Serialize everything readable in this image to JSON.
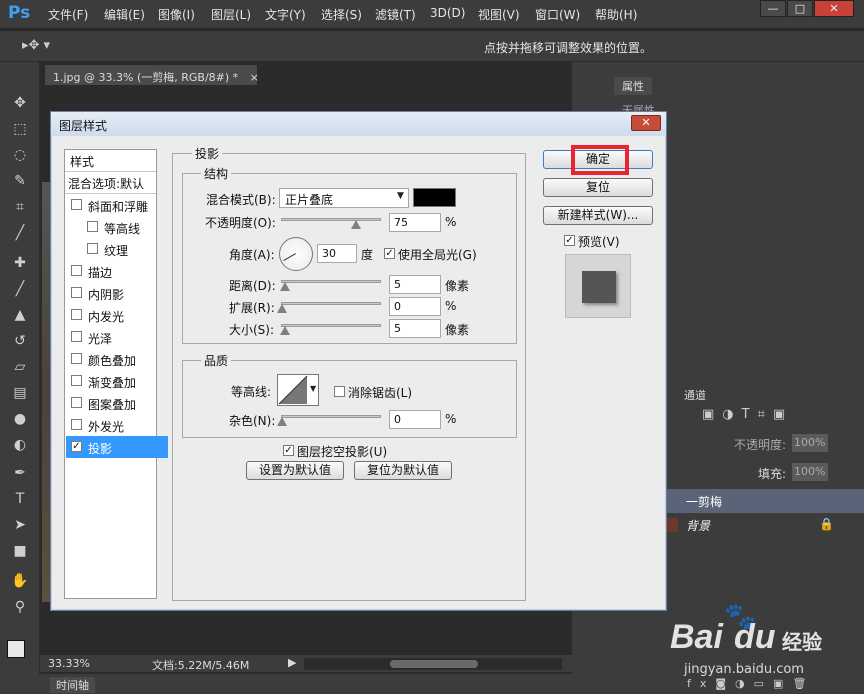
{
  "app": {
    "logo": "Ps"
  },
  "menu": [
    "文件(F)",
    "编辑(E)",
    "图像(I)",
    "图层(L)",
    "文字(Y)",
    "选择(S)",
    "滤镜(T)",
    "3D(D)",
    "视图(V)",
    "窗口(W)",
    "帮助(H)"
  ],
  "options_bar": {
    "hint": "点按并拖移可调整效果的位置。"
  },
  "document": {
    "tab_title": "1.jpg @ 33.3% (一剪梅, RGB/8#) *",
    "zoom": "33.33%",
    "doc_size": "文档:5.22M/5.46M",
    "timeline_tab": "时间轴"
  },
  "right_panel": {
    "properties_tab": "属性",
    "no_properties": "无属性",
    "channels_tab": "通道",
    "opacity_label": "不透明度:",
    "opacity_value": "100%",
    "fill_label": "填充:",
    "fill_value": "100%",
    "layers": [
      {
        "name": "一剪梅"
      },
      {
        "name": "背景"
      }
    ]
  },
  "dialog": {
    "title": "图层样式",
    "styles_header": "样式",
    "blend_options": "混合选项:默认",
    "style_items": [
      {
        "label": "斜面和浮雕",
        "checked": false,
        "indent": false
      },
      {
        "label": "等高线",
        "checked": false,
        "indent": true
      },
      {
        "label": "纹理",
        "checked": false,
        "indent": true
      },
      {
        "label": "描边",
        "checked": false,
        "indent": false
      },
      {
        "label": "内阴影",
        "checked": false,
        "indent": false
      },
      {
        "label": "内发光",
        "checked": false,
        "indent": false
      },
      {
        "label": "光泽",
        "checked": false,
        "indent": false
      },
      {
        "label": "颜色叠加",
        "checked": false,
        "indent": false
      },
      {
        "label": "渐变叠加",
        "checked": false,
        "indent": false
      },
      {
        "label": "图案叠加",
        "checked": false,
        "indent": false
      },
      {
        "label": "外发光",
        "checked": false,
        "indent": false
      },
      {
        "label": "投影",
        "checked": true,
        "indent": false
      }
    ],
    "section_title": "投影",
    "structure_title": "结构",
    "blend_mode_label": "混合模式(B):",
    "blend_mode_value": "正片叠底",
    "blend_color": "#000000",
    "opacity_label": "不透明度(O):",
    "opacity_value": "75",
    "percent": "%",
    "angle_label": "角度(A):",
    "angle_value": "30",
    "degree": "度",
    "global_light_label": "使用全局光(G)",
    "global_light_checked": true,
    "distance_label": "距离(D):",
    "distance_value": "5",
    "spread_label": "扩展(R):",
    "spread_value": "0",
    "size_label": "大小(S):",
    "size_value": "5",
    "pixels": "像素",
    "quality_title": "品质",
    "contour_label": "等高线:",
    "antialias_label": "消除锯齿(L)",
    "antialias_checked": false,
    "noise_label": "杂色(N):",
    "noise_value": "0",
    "knockout_label": "图层挖空投影(U)",
    "knockout_checked": true,
    "make_default": "设置为默认值",
    "reset_default": "复位为默认值",
    "ok": "确定",
    "reset": "复位",
    "new_style": "新建样式(W)...",
    "preview_label": "预览(V)",
    "preview_checked": true,
    "highlight_color": "#e8262b"
  },
  "watermark": {
    "brand": "Bai",
    "brand2": "经验",
    "url": "jingyan.baidu.com"
  }
}
